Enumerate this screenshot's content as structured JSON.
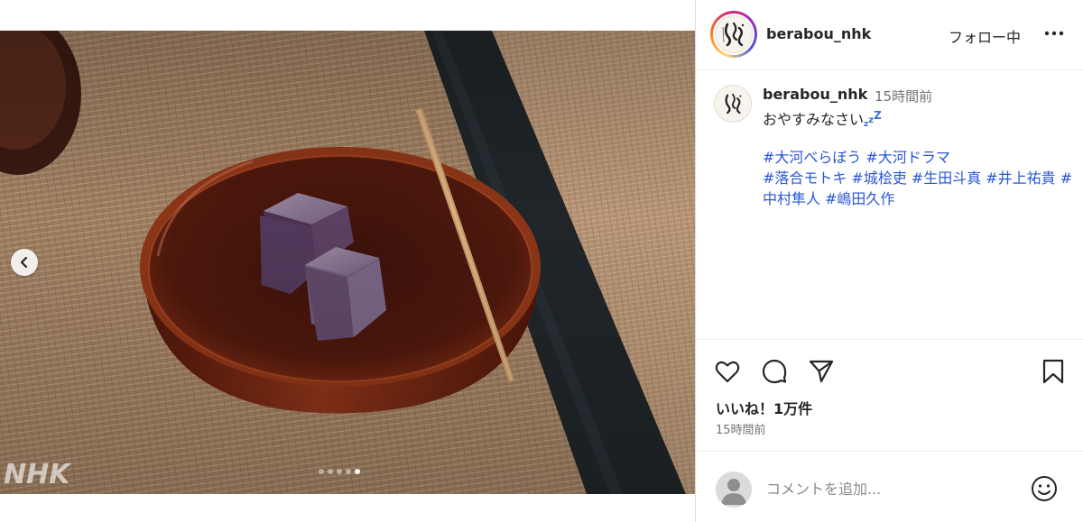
{
  "post": {
    "username": "berabou_nhk",
    "follow_label": "フォロー中",
    "more_icon": "more-horizontal-icon",
    "watermark": "NHK",
    "carousel": {
      "prev_icon": "chevron-left-icon",
      "slide_count": 5,
      "active_index": 4
    }
  },
  "caption": {
    "username": "berabou_nhk",
    "time": "15時間前",
    "text": "おやすみなさい",
    "zz": [
      "z",
      "z",
      "Z"
    ],
    "hashtags": [
      "#大河べらぼう",
      "#大河ドラマ",
      "#落合モトキ",
      "#城桧吏",
      "#生田斗真",
      "#井上祐貴",
      "#中村隼人",
      "#嶋田久作"
    ]
  },
  "actions": {
    "like_icon": "heart-icon",
    "comment_icon": "comment-icon",
    "share_icon": "send-icon",
    "save_icon": "bookmark-icon",
    "likes_text": "いいね！1万件",
    "timestamp": "15時間前"
  },
  "comment": {
    "placeholder": "コメントを追加...",
    "emoji_icon": "smiley-icon"
  },
  "colors": {
    "hashtag": "#2a57d6",
    "text": "#262626",
    "muted": "#737373",
    "divider": "#efefef"
  }
}
